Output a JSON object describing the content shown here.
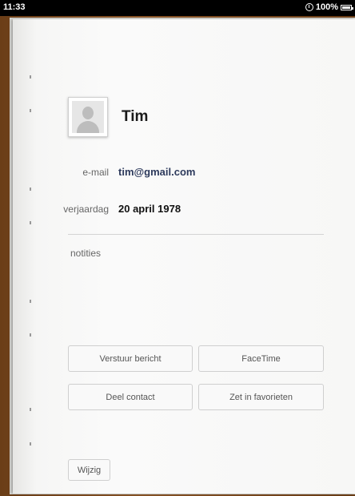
{
  "status_bar": {
    "time": "11:33",
    "battery_percent": "100%"
  },
  "contact": {
    "name": "Tim",
    "email_label": "e-mail",
    "email": "tim@gmail.com",
    "birthday_label": "verjaardag",
    "birthday": "20 april 1978",
    "notes_label": "notities"
  },
  "actions": {
    "send_message": "Verstuur bericht",
    "facetime": "FaceTime",
    "share_contact": "Deel contact",
    "add_favorite": "Zet in favorieten",
    "edit": "Wijzig"
  },
  "colors": {
    "email_value": "#2d3a5c",
    "birthday_value": "#111111",
    "leather": "#7a4a1e",
    "paper": "#f7f7f6"
  }
}
